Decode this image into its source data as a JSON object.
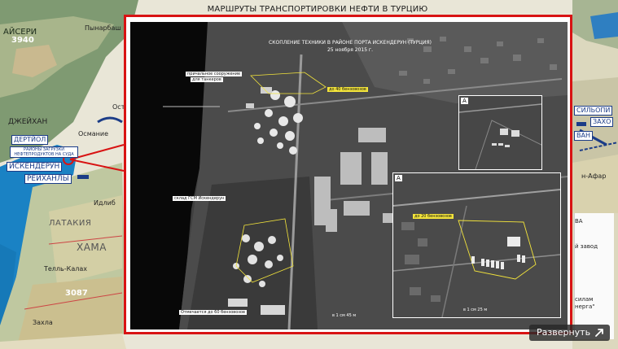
{
  "map": {
    "title": "МАРШРУТЫ ТРАНСПОРТИРОВКИ НЕФТИ В ТУРЦИЮ",
    "places": {
      "kayseri": "АЙСЕРИ",
      "elev_3940": "3940",
      "pynarbash": "Пынарбаш",
      "dzheyhan": "ДЖЕЙХАН",
      "dertyol": "ДЕРТЙОЛ",
      "osmanie": "Османие",
      "loading_zone": "РАЙОНЫ ЗАГРУЗКИ НЕФТЕПРОДУКТОВ НА СУДА",
      "iskenderun": "ИСКЕНДЕРУН",
      "reyhanly": "РЕЙХАНЛЫ",
      "idlib": "Идлиб",
      "latakia": "ЛАТАКИЯ",
      "hama": "ХАМА",
      "tell_kalah": "Телль-Калах",
      "elev_3087": "3087",
      "zahla": "Захла",
      "silopi": "СИЛЬОПИ",
      "zaho": "ЗАХО",
      "van": "ВАН",
      "nafar": "н-Афар",
      "zavod": "й завод",
      "sil": "силам",
      "nerga": "нерга\"",
      "ostb": "Ост"
    },
    "legend_lines": [
      "ВА",
      "",
      "й завод",
      "",
      "",
      "",
      "силам",
      "нерга\""
    ]
  },
  "photo": {
    "title_line1": "СКОПЛЕНИЕ ТЕХНИКИ В РАЙОНЕ ПОРТА ИСКЕНДЕРУН (ТУРЦИЯ)",
    "title_line2": "25 ноября 2015 г.",
    "pier_label_1": "причальное сооружение",
    "pier_label_2": "для танкеров",
    "depot_label": "склад ГСМ Искендерун",
    "parked_label": "Отмечается до 60 бензовозов",
    "tanker_count_label": "до 40 бензовозов",
    "scale_main": "в 1 см 45 м",
    "inset_small": {
      "letter": "А"
    },
    "inset_large": {
      "letter": "А",
      "count_label": "до 20 бензовозов",
      "scale": "в 1 см 25 м"
    }
  },
  "controls": {
    "expand_label": "Развернуть"
  },
  "colors": {
    "frame": "#d81313",
    "highlight": "#f3e43b",
    "sea": "#1a82c4",
    "button_bg": "#2b2b2b"
  }
}
